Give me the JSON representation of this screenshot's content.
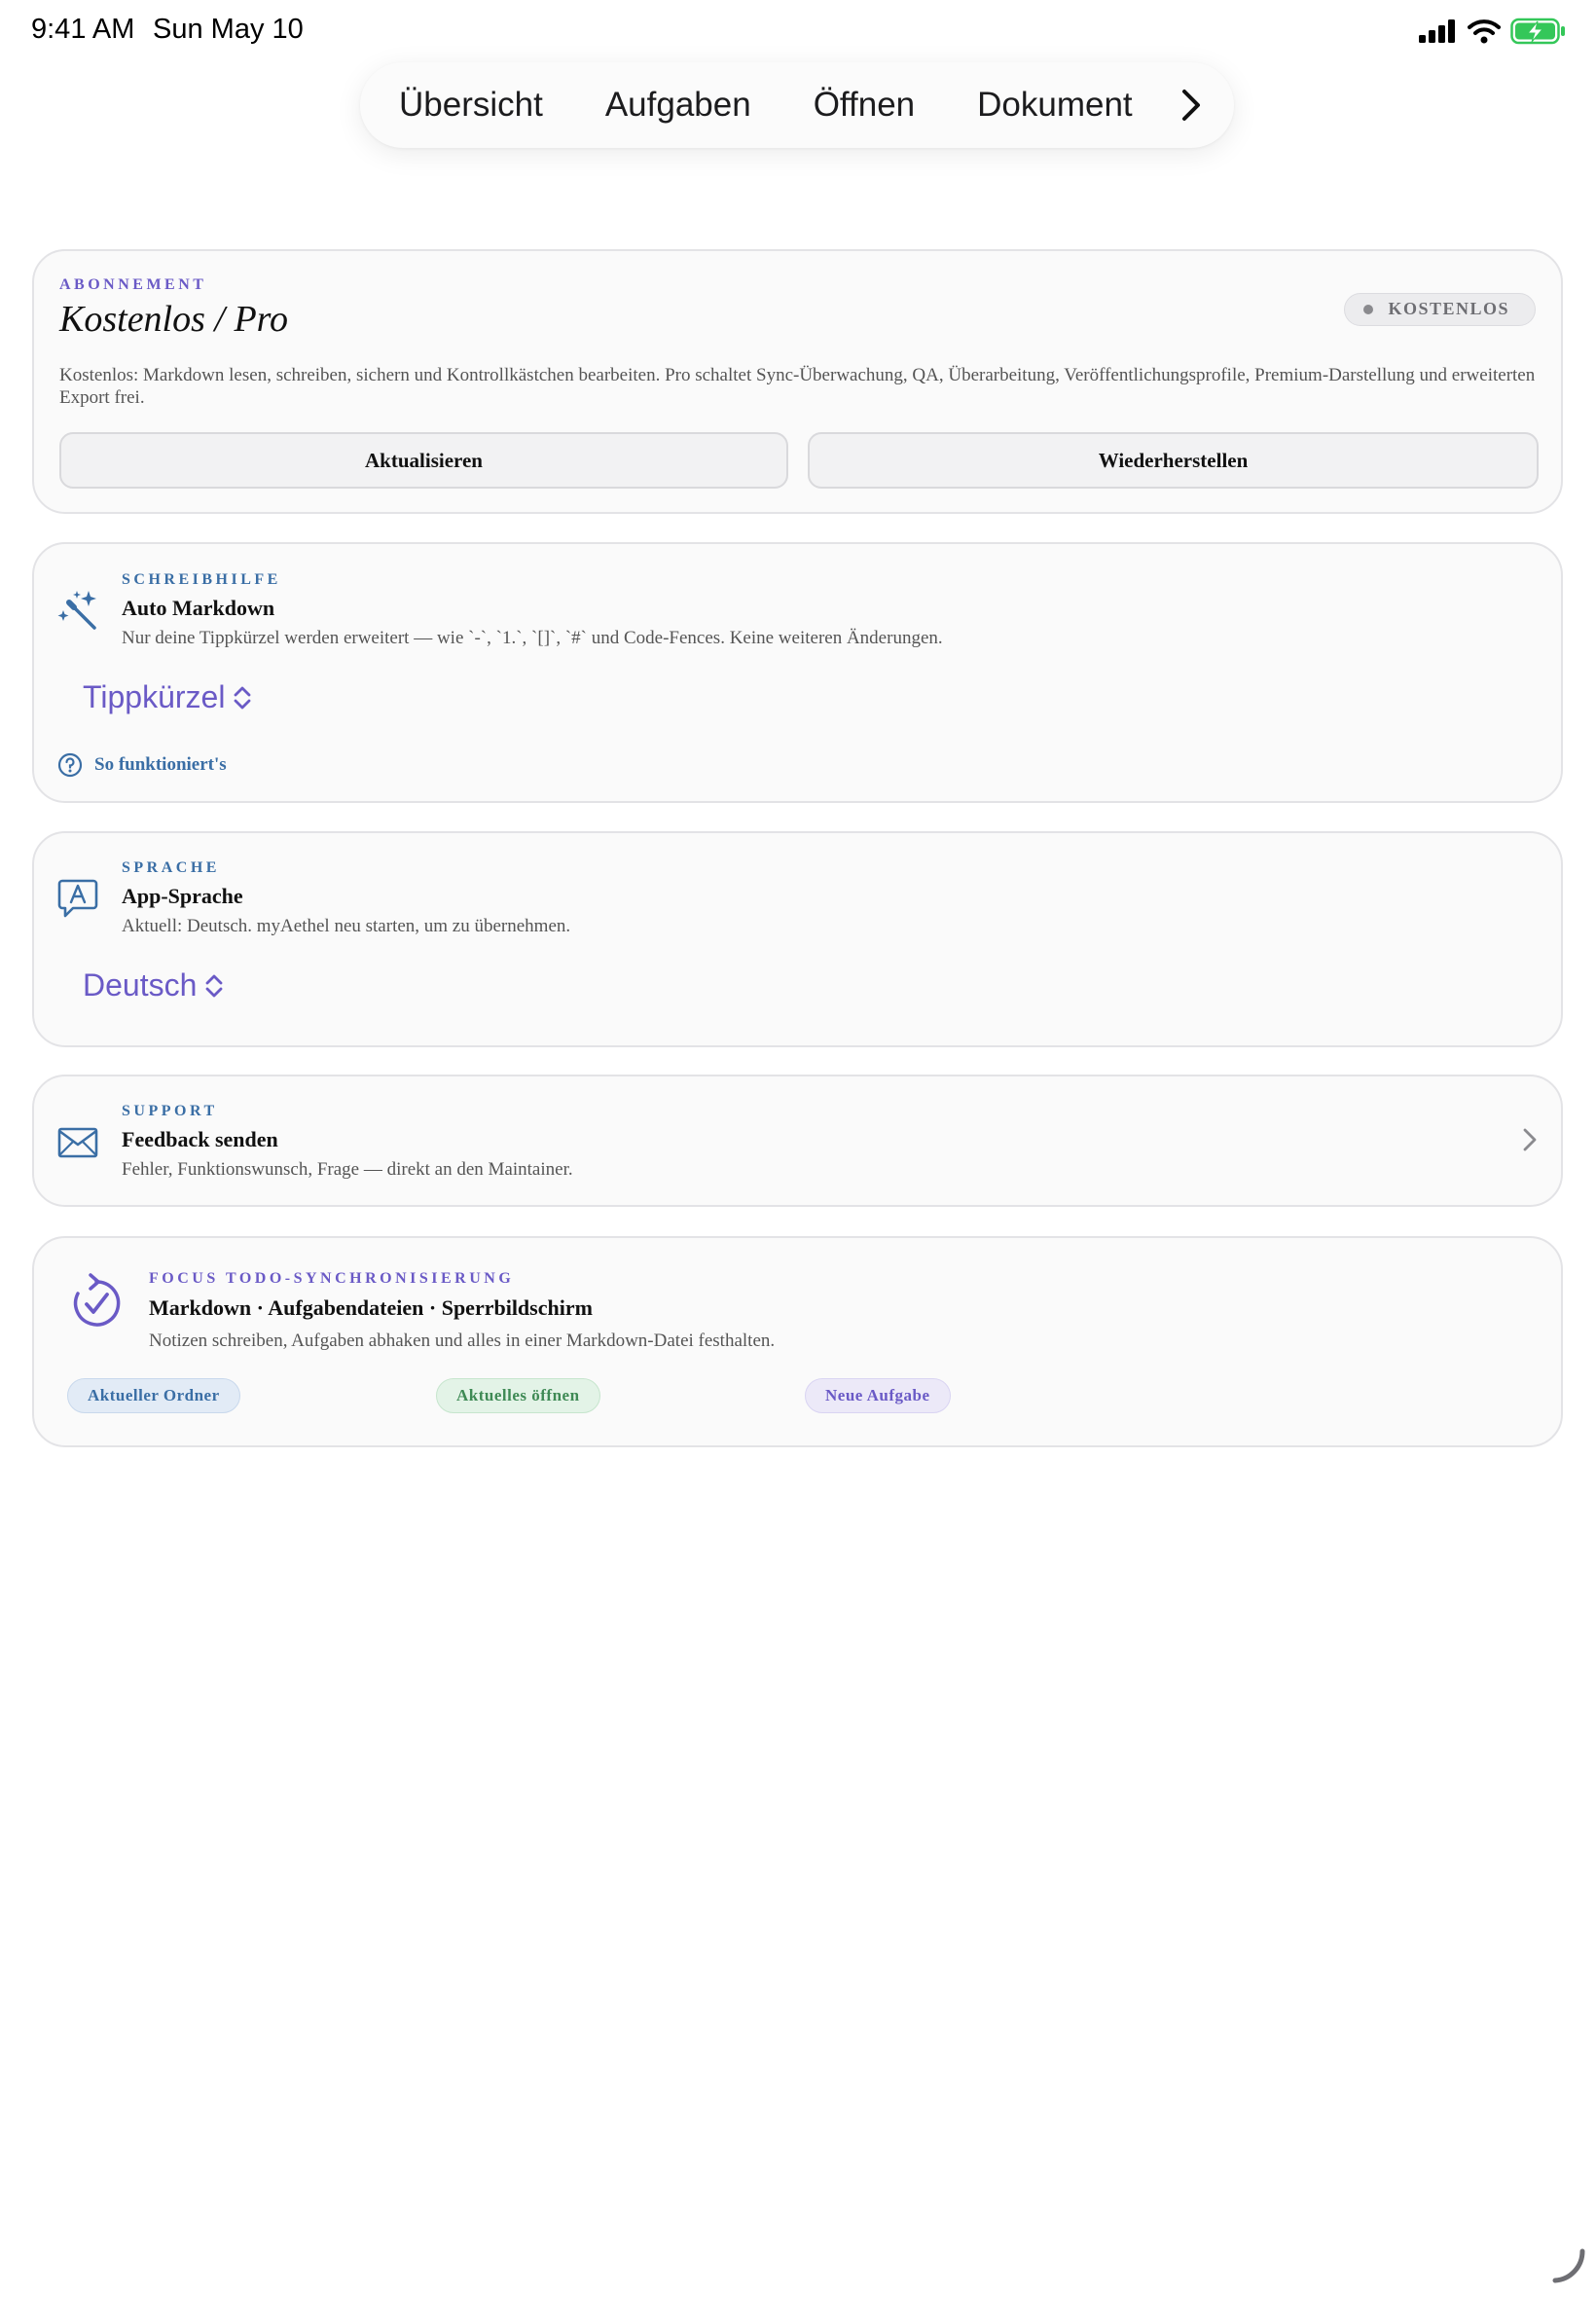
{
  "status_bar": {
    "time": "9:41 AM",
    "date": "Sun May 10"
  },
  "tabs": [
    {
      "label": "Übersicht"
    },
    {
      "label": "Aufgaben"
    },
    {
      "label": "Öffnen"
    },
    {
      "label": "Dokument"
    }
  ],
  "subscription": {
    "eyebrow": "ABONNEMENT",
    "title": "Kostenlos / Pro",
    "badge": "KOSTENLOS",
    "description": "Kostenlos: Markdown lesen, schreiben, sichern und Kontrollkästchen bearbeiten. Pro schaltet Sync-Überwachung, QA, Überarbeitung, Veröffentlichungsprofile, Premium-Darstellung und erweiterten Export frei.",
    "update_label": "Aktualisieren",
    "restore_label": "Wiederherstellen"
  },
  "writing": {
    "eyebrow": "SCHREIBHILFE",
    "title": "Auto Markdown",
    "description": "Nur deine Tippkürzel werden erweitert — wie `-`, `1.`, `[]`, `#` und Code-Fences. Keine weiteren Änderungen.",
    "picker_value": "Tippkürzel",
    "help_label": "So funktioniert's"
  },
  "language": {
    "eyebrow": "SPRACHE",
    "title": "App-Sprache",
    "description": "Aktuell: Deutsch. myAethel neu starten, um zu übernehmen.",
    "picker_value": "Deutsch"
  },
  "support": {
    "eyebrow": "SUPPORT",
    "title": "Feedback senden",
    "description": "Fehler, Funktionswunsch, Frage — direkt an den Maintainer."
  },
  "focus": {
    "eyebrow": "FOCUS TODO-SYNCHRONISIERUNG",
    "title": "Markdown · Aufgabendateien · Sperrbildschirm",
    "description": "Notizen schreiben, Aufgaben abhaken und alles in einer Markdown-Datei festhalten.",
    "chips": [
      {
        "label": "Aktueller Ordner"
      },
      {
        "label": "Aktuelles öffnen"
      },
      {
        "label": "Neue Aufgabe"
      }
    ]
  },
  "icons": {
    "tab_more": "chevron-right-icon",
    "writing": "magic-wand-icon",
    "language": "language-bubble-icon",
    "support": "envelope-icon",
    "focus": "sync-check-icon",
    "help": "question-circle-icon",
    "picker": "chevron-up-down-icon"
  },
  "colors": {
    "accent_purple": "#6a5ac6",
    "accent_blue": "#3a6ea5",
    "accent_green": "#3f8a55",
    "battery_green": "#34c759"
  }
}
